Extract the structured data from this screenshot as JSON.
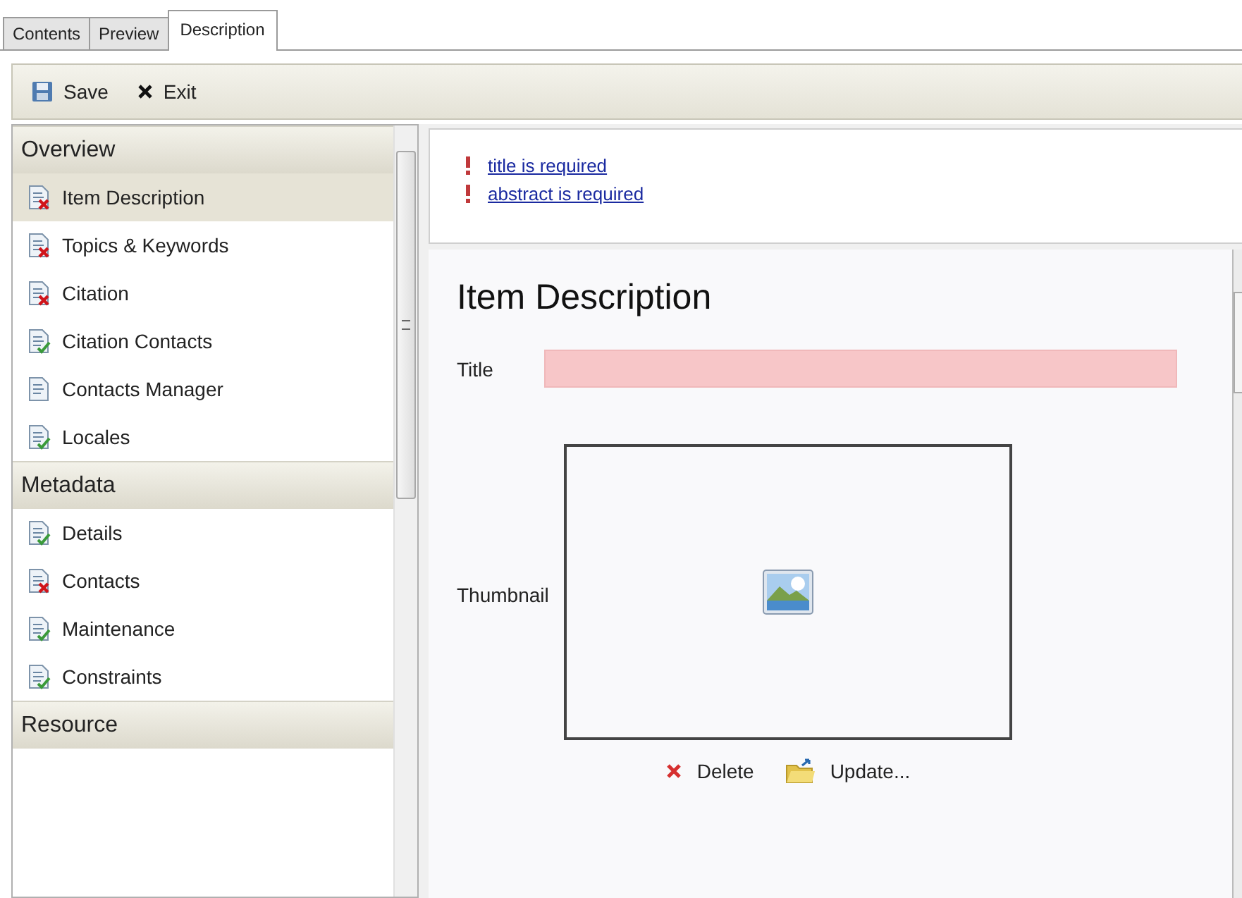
{
  "tabs": [
    {
      "label": "Contents",
      "selected": false
    },
    {
      "label": "Preview",
      "selected": false
    },
    {
      "label": "Description",
      "selected": true
    }
  ],
  "toolbar": [
    {
      "kind": "save",
      "label": "Save"
    },
    {
      "kind": "exit",
      "label": "Exit"
    }
  ],
  "sidebar": {
    "sections": [
      {
        "title": "Overview",
        "items": [
          {
            "label": "Item Description",
            "kind": "error",
            "selected": true
          },
          {
            "label": "Topics & Keywords",
            "kind": "error",
            "selected": false
          },
          {
            "label": "Citation",
            "kind": "error",
            "selected": false
          },
          {
            "label": "Citation Contacts",
            "kind": "valid",
            "selected": false
          },
          {
            "label": "Contacts Manager",
            "kind": "plain",
            "selected": false
          },
          {
            "label": "Locales",
            "kind": "valid",
            "selected": false
          }
        ]
      },
      {
        "title": "Metadata",
        "items": [
          {
            "label": "Details",
            "kind": "valid",
            "selected": false
          },
          {
            "label": "Contacts",
            "kind": "error",
            "selected": false
          },
          {
            "label": "Maintenance",
            "kind": "valid",
            "selected": false
          },
          {
            "label": "Constraints",
            "kind": "valid",
            "selected": false
          }
        ]
      },
      {
        "title": "Resource"
      }
    ]
  },
  "errors": [
    "title is required",
    "abstract is required"
  ],
  "page": {
    "heading": "Item Description",
    "title_label": "Title",
    "thumbnail_label": "Thumbnail",
    "thumbnail_actions": [
      {
        "kind": "delete",
        "label": "Delete"
      },
      {
        "kind": "update",
        "label": "Update..."
      }
    ]
  }
}
